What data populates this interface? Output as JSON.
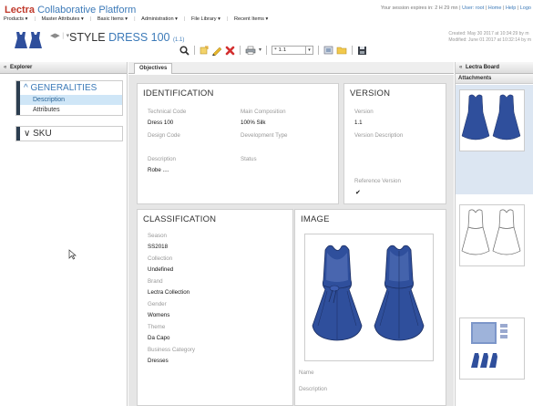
{
  "app": {
    "brand_part1": "Lectra",
    "brand_part2": "Collaborative Platform",
    "session_text": "Your session expires in: 2 H 29 mn",
    "user_label": "User: root",
    "home_link": "Home",
    "help_link": "Help",
    "logout_link": "Logo"
  },
  "menu": [
    "Products ▾",
    "Master Attributes ▾",
    "Basic Items ▾",
    "Administration ▾",
    "File Library ▾",
    "Recent Items ▾"
  ],
  "header": {
    "style_prefix": "STYLE",
    "style_name": "DRESS 100",
    "style_version": "(1.1)",
    "created": "Created: May 30 2017 at 10:34:29 by m",
    "modified": "Modified: June 01 2017 at 10:32:14 by m"
  },
  "toolbar": {
    "version_value": "* 1.1",
    "icons": [
      "search-icon",
      "new-icon",
      "edit-icon",
      "delete-icon",
      "print-icon",
      "notes-icon",
      "folder-icon",
      "save-icon"
    ]
  },
  "explorer": {
    "title": "Explorer",
    "groups": [
      {
        "title": "GENERALITIES",
        "items": [
          "Description",
          "Attributes"
        ],
        "expanded": true
      },
      {
        "title": "SKU",
        "items": [],
        "expanded": false
      }
    ]
  },
  "tabs": {
    "objectives": "Objectives"
  },
  "identification": {
    "title": "IDENTIFICATION",
    "technical_code_label": "Technical Code",
    "technical_code": "Dress 100",
    "main_composition_label": "Main Composition",
    "main_composition": "100% Silk",
    "design_code_label": "Design Code",
    "development_type_label": "Development Type",
    "description_label": "Description",
    "description": "Robe ....",
    "status_label": "Status"
  },
  "version": {
    "title": "VERSION",
    "version_label": "Version",
    "version": "1.1",
    "version_description_label": "Version Description",
    "reference_version_label": "Reference Version",
    "reference_version_check": "✔"
  },
  "classification": {
    "title": "CLASSIFICATION",
    "fields": [
      {
        "label": "Season",
        "value": "SS2018"
      },
      {
        "label": "Collection",
        "value": "Undefined"
      },
      {
        "label": "Brand",
        "value": "Lectra Collection"
      },
      {
        "label": "Gender",
        "value": "Womens"
      },
      {
        "label": "Theme",
        "value": "Da Capo"
      },
      {
        "label": "Business Category",
        "value": "Dresses"
      }
    ]
  },
  "image": {
    "title": "IMAGE",
    "name_label": "Name",
    "description_label": "Description"
  },
  "lectra_board": {
    "title": "Lectra Board",
    "attachments_label": "Attachments"
  },
  "colors": {
    "brand_red": "#c0392b",
    "accent_blue": "#3c7ab8",
    "dress_blue": "#2f4f9c",
    "selection": "#cfe6f7"
  }
}
